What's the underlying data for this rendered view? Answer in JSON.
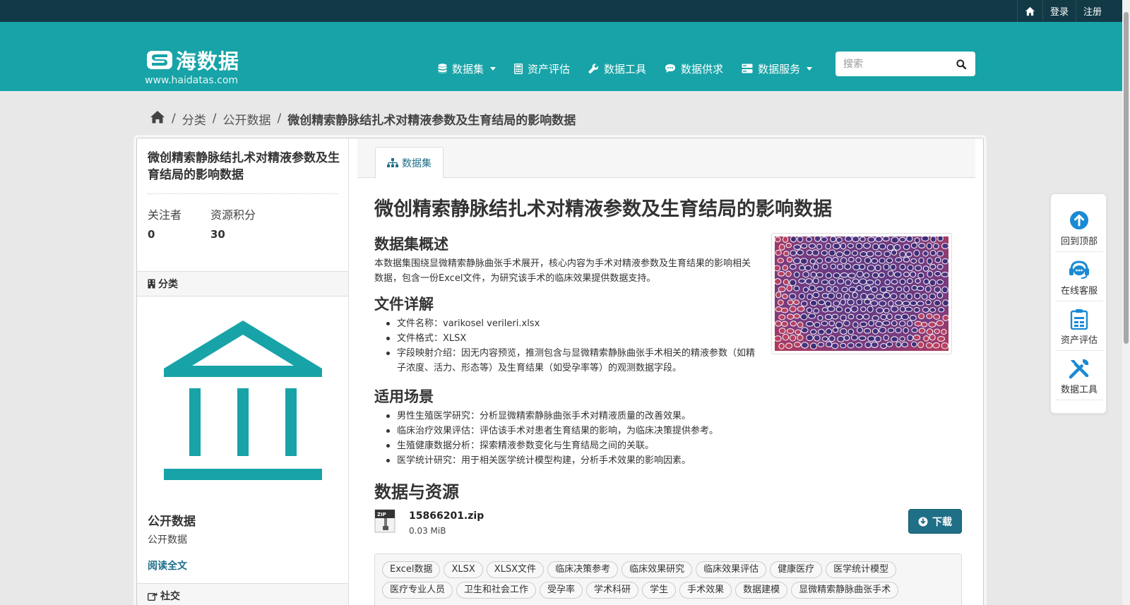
{
  "topbar": {
    "login": "登录",
    "register": "注册"
  },
  "brand": {
    "name": "海数据",
    "url": "www.haidatas.com",
    "color": "#17a3a7"
  },
  "nav": {
    "items": [
      {
        "label": "数据集",
        "icon": "database-icon",
        "dropdown": true
      },
      {
        "label": "资产评估",
        "icon": "calculator-icon",
        "dropdown": false
      },
      {
        "label": "数据工具",
        "icon": "wrench-icon",
        "dropdown": false
      },
      {
        "label": "数据供求",
        "icon": "comment-icon",
        "dropdown": false
      },
      {
        "label": "数据服务",
        "icon": "server-icon",
        "dropdown": true
      }
    ]
  },
  "search": {
    "placeholder": "搜索"
  },
  "breadcrumb": {
    "items": [
      "分类",
      "公开数据"
    ],
    "current": "微创精索静脉结扎术对精液参数及生育结局的影响数据"
  },
  "sidebar": {
    "title": "微创精索静脉结扎术对精液参数及生育结局的影响数据",
    "followers_label": "关注者",
    "followers_value": "0",
    "points_label": "资源积分",
    "points_value": "30",
    "category_heading": "分类",
    "org_title": "公开数据",
    "org_desc": "公开数据",
    "read_more": "阅读全文",
    "social_heading": "社交"
  },
  "main": {
    "tab_label": "数据集",
    "title": "微创精索静脉结扎术对精液参数及生育结局的影响数据",
    "overview_heading": "数据集概述",
    "overview_text": "本数据集围绕显微精索静脉曲张手术展开，核心内容为手术对精液参数及生育结果的影响相关数据，包含一份Excel文件，为研究该手术的临床效果提供数据支持。",
    "file_heading": "文件详解",
    "file_items": [
      "文件名称：varikosel verileri.xlsx",
      "文件格式：XLSX",
      "字段映射介绍：因无内容预览，推测包含与显微精索静脉曲张手术相关的精液参数（如精子浓度、活力、形态等）及生育结果（如受孕率等）的观测数据字段。"
    ],
    "scenario_heading": "适用场景",
    "scenario_items": [
      "男性生殖医学研究：分析显微精索静脉曲张手术对精液质量的改善效果。",
      "临床治疗效果评估：评估该手术对患者生育结果的影响，为临床决策提供参考。",
      "生殖健康数据分析：探索精液参数变化与生育结局之间的关联。",
      "医学统计研究：用于相关医学统计模型构建，分析手术效果的影响因素。"
    ],
    "resources_heading": "数据与资源",
    "resource": {
      "badge": "ZIP",
      "name": "15866201.zip",
      "size": "0.03 MiB",
      "download_label": "下载"
    },
    "tags": [
      "Excel数据",
      "XLSX",
      "XLSX文件",
      "临床决策参考",
      "临床效果研究",
      "临床效果评估",
      "健康医疗",
      "医学统计模型",
      "医疗专业人员",
      "卫生和社会工作",
      "受孕率",
      "学术科研",
      "学生",
      "手术效果",
      "数据建模",
      "显微精索静脉曲张手术"
    ]
  },
  "float_panel": {
    "items": [
      {
        "label": "回到顶部",
        "icon": "arrow-up-circle-icon"
      },
      {
        "label": "在线客服",
        "icon": "headset-icon"
      },
      {
        "label": "资产评估",
        "icon": "clipboard-icon"
      },
      {
        "label": "数据工具",
        "icon": "tools-icon"
      }
    ]
  }
}
